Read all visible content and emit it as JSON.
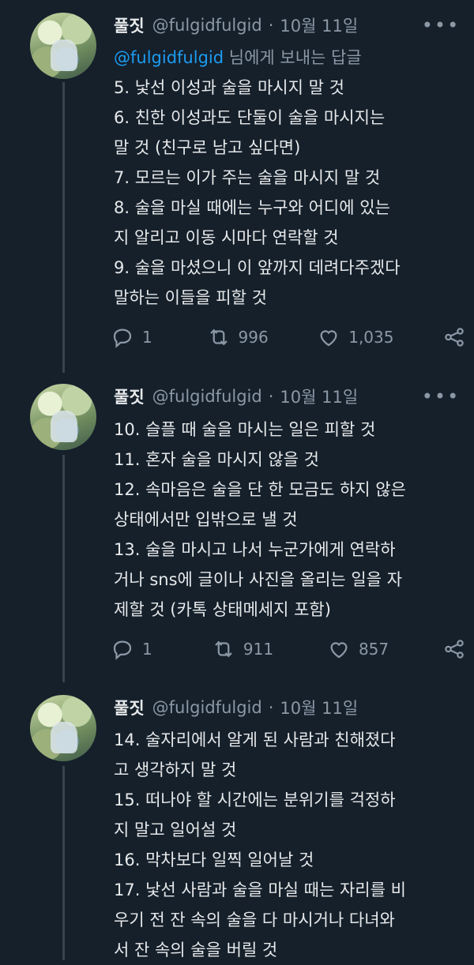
{
  "tweets": [
    {
      "name": "풀짓",
      "handle": "@fulgidfulgid",
      "date": "10월 11일",
      "replying_to": "@fulgidfulgid",
      "replying_suffix": " 님에게 보내는 답글",
      "lines": [
        "5. 낯선 이성과 술을 마시지 말 것",
        "6. 친한 이성과도 단둘이 술을 마시지는",
        "말 것 (친구로 남고 싶다면)",
        "7. 모르는 이가 주는 술을 마시지 말 것",
        "8. 술을 마실 때에는 누구와 어디에 있는",
        "지 알리고 이동 시마다 연락할 것",
        "9. 술을 마셨으니 이 앞까지 데려다주겠다",
        "말하는 이들을 피할 것"
      ],
      "replies": "1",
      "retweets": "996",
      "likes": "1,035"
    },
    {
      "name": "풀짓",
      "handle": "@fulgidfulgid",
      "date": "10월 11일",
      "lines": [
        "10. 슬플 때 술을 마시는 일은 피할 것",
        "11. 혼자 술을 마시지 않을 것",
        "12. 속마음은 술을 단 한 모금도 하지 않은",
        "상태에서만 입밖으로 낼 것",
        "13. 술을 마시고 나서 누군가에게 연락하",
        "거나 sns에 글이나 사진을 올리는 일을 자",
        "제할 것 (카톡 상태메세지 포함)"
      ],
      "replies": "1",
      "retweets": "911",
      "likes": "857"
    },
    {
      "name": "풀짓",
      "handle": "@fulgidfulgid",
      "date": "10월 11일",
      "lines": [
        "14. 술자리에서 알게 된 사람과 친해졌다",
        "고 생각하지 말 것",
        "15. 떠나야 할 시간에는 분위기를 걱정하",
        "지 말고 일어설 것",
        "16. 막차보다 일찍 일어날 것",
        "17. 낯선 사람과 술을 마실 때는 자리를 비",
        "우기 전 잔 속의 술을 다 마시거나 다녀와",
        "서 잔 속의 술을 버릴 것"
      ]
    }
  ],
  "icons": {
    "more": "more-icon",
    "reply": "reply-icon",
    "retweet": "retweet-icon",
    "like": "heart-icon",
    "share": "share-icon"
  },
  "colors": {
    "background": "#15202b",
    "text": "#e7e9ea",
    "secondary": "#8b98a5",
    "link": "#1d9bf0",
    "divider": "#38444d"
  }
}
